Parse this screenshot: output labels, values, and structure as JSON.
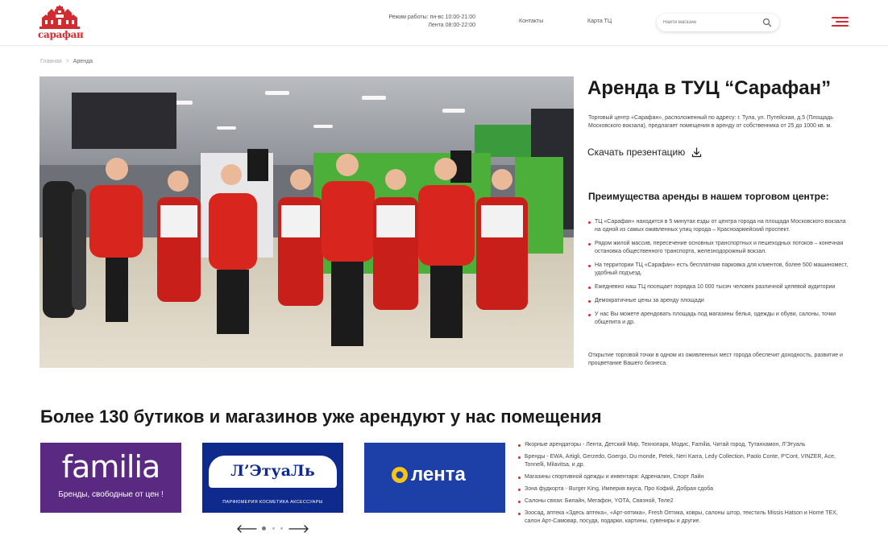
{
  "logo": {
    "text": "сарафан"
  },
  "header": {
    "hours_line1": "Режим работы: пн-вс 10:00-21:00",
    "hours_line2": "Лента 08:00-22:00",
    "nav": [
      "Контакты",
      "Карта ТЦ"
    ],
    "search_placeholder": "Найти магазин"
  },
  "breadcrumb": {
    "home": "Главная",
    "separator": ">",
    "current": "Аренда"
  },
  "main": {
    "title": "Аренда в ТУЦ “Сарафан”",
    "intro": "Торговый центр «Сарафан», расположенный по адресу: г. Тула, ул. Путейская, д.5 (Площадь Московского вокзала), предлагает помещения в аренду от собственника от 25 до 1000 кв. м.",
    "download_label": "Скачать презентацию",
    "advantages_title": "Преимущества аренды в нашем торговом центре:",
    "advantages": [
      "ТЦ «Сарафан» находится в 5 минутах езды от центра города на площади Московского вокзала на одной из самых оживленных улиц города – Красноармейский проспект.",
      "Рядом жилой массив, пересечение основных транспортных и пешеходных потоков – конечная остановка общественного транспорта, железнодорожный вокзал.",
      "На территории ТЦ «Сарафан» есть бесплатная парковка для клиентов, более 500 машиномест, удобный подъезд.",
      "Ежедневно наш ТЦ посещает порядка 10 000 тысяч человек различной целевой аудитории",
      "Демократичные цены за аренду площади",
      "У нас Вы можете арендовать площадь под магазины белья, одежды и обуви, салоны, точки общепита и др."
    ],
    "closing": "Открытие торговой точки в одном из оживленных мест города обеспечит доходность, развитие и процветание Вашего бизнеса."
  },
  "tenants": {
    "title": "Более 130 бутиков и магазинов уже арендуют у нас помещения",
    "brands": [
      {
        "name": "familia",
        "tagline": "Бренды, свободные от цен !",
        "color": "#5a2a83"
      },
      {
        "name": "Л’ЭтуаЛь",
        "tagline": "ПАРФЮМЕРИЯ  КОСМЕТИКА  АКСЕССУАРЫ",
        "color": "#0d2a8c"
      },
      {
        "name": "лента",
        "tagline": "",
        "color": "#1d3fa8"
      }
    ],
    "list": [
      "Якорные арендаторы - Лента, Детский Мир, Технопарк, Модис, Familia, Читай город, Тутанхамон, Л'Этуаль",
      "Бренды - EWA, Artigli, Gerzedo, Goergo, Du monde, Petek, Neri Karra, Ledy Collection, Paolo Conte, P'Cont, VINZER, Ace, Tonnelli, Milavitsa, и др.",
      "Магазины спортивной одежды и инвентаря: Адреналин, Спорт Лайн",
      "Зона фудкорта - Burger King, Империя вкуса, Про Кофий, Добрая сдоба",
      "Салоны связи: Билайн, Мегафон, YOTA, Связной, Теле2",
      "Зоосад, аптека «Здесь аптека», «Арт-оптика», Fresh Оптика, ковры, салоны штор, текстиль Missis Hatson и Home TEX, салон Арт-Самовар, посуда, подарки, картины, сувениры и другие."
    ]
  },
  "colors": {
    "accent": "#d32a2f",
    "text": "#222222"
  }
}
